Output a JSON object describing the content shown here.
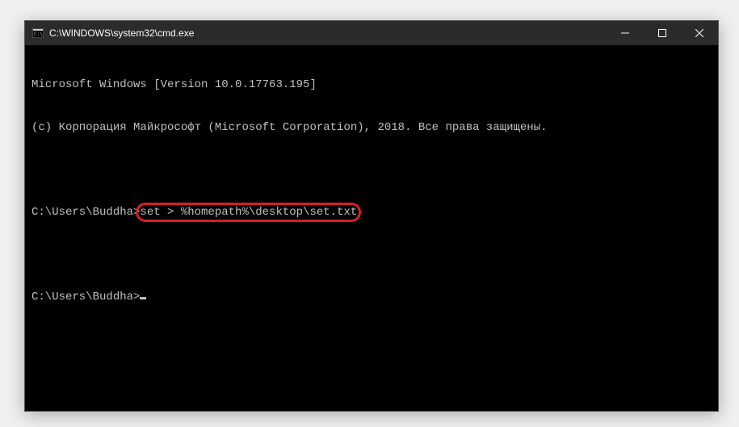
{
  "window": {
    "title": "C:\\WINDOWS\\system32\\cmd.exe"
  },
  "terminal": {
    "header_line1": "Microsoft Windows [Version 10.0.17763.195]",
    "header_line2": "(c) Корпорация Майкрософт (Microsoft Corporation), 2018. Все права защищены.",
    "prompt1": "C:\\Users\\Buddha>",
    "command1": "set > %homepath%\\desktop\\set.txt",
    "prompt2": "C:\\Users\\Buddha>"
  }
}
